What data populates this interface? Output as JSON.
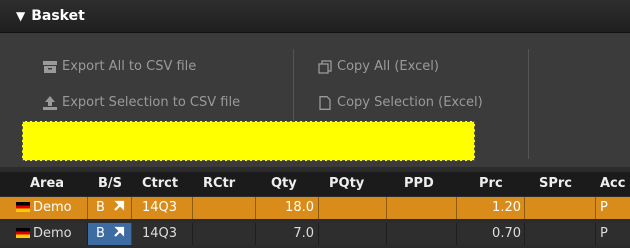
{
  "title": "Basket",
  "toolbar": {
    "export_all": "Export All to CSV file",
    "export_selection": "Export Selection to CSV file",
    "copy_all": "Copy All (Excel)",
    "copy_selection": "Copy Selection (Excel)"
  },
  "columns": [
    "Area",
    "B/S",
    "Ctrct",
    "RCtr",
    "Qty",
    "PQty",
    "PPD",
    "Prc",
    "SPrc",
    "Acc"
  ],
  "rows": [
    {
      "area": "Demo",
      "bs": "B",
      "ctrct": "14Q3",
      "qty": "18.0",
      "prc": "1.20",
      "acc": "P"
    },
    {
      "area": "Demo",
      "bs": "B",
      "ctrct": "14Q3",
      "qty": "7.0",
      "prc": "0.70",
      "acc": "P"
    }
  ],
  "colors": {
    "selected_row": "#d98c1a",
    "buy_badge": "#3d6ca3",
    "highlight": "#ffff00"
  }
}
